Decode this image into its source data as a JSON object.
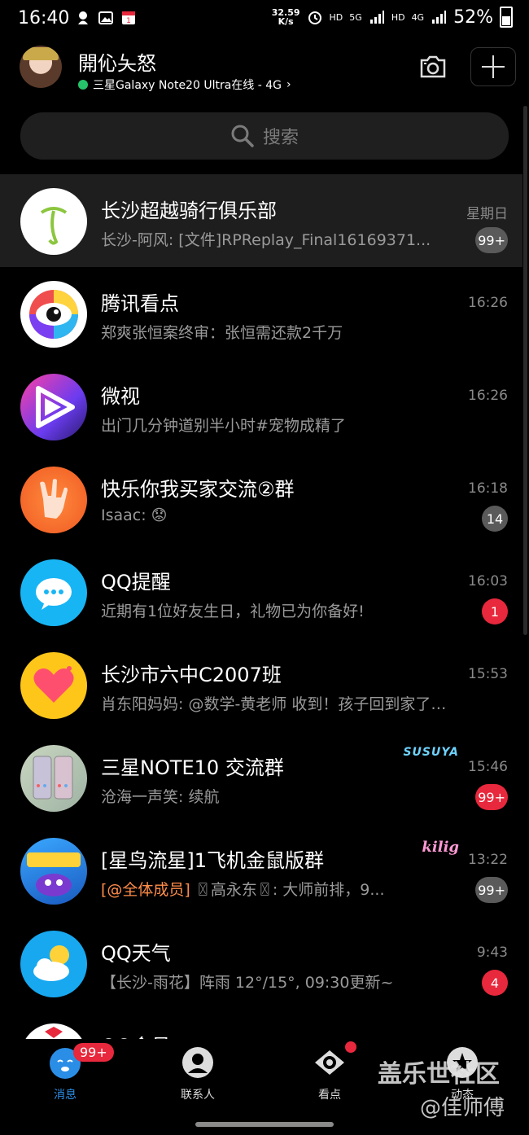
{
  "status_bar": {
    "time": "16:40",
    "speed_top": "32.59",
    "speed_bottom": "K/s",
    "hd1": "HD",
    "net5g": "5G",
    "hd2": "HD",
    "net4g": "4G",
    "battery": "52%"
  },
  "header": {
    "name": "開伈夨怒",
    "device_status": "三星Galaxy Note20 Ultra在线 - 4G",
    "chevron": "›"
  },
  "search": {
    "placeholder": "搜索"
  },
  "chats": [
    {
      "title": "长沙超越骑行俱乐部",
      "message": "长沙-阿风: [文件]RPReplay_Final16169371...",
      "time": "星期日",
      "badge": "99+",
      "badge_color": "grey",
      "pinned": true
    },
    {
      "title": "腾讯看点",
      "message": "郑爽张恒案终审：张恒需还款2千万",
      "time": "16:26",
      "badge": "",
      "badge_color": ""
    },
    {
      "title": "微视",
      "message": "出门几分钟道别半小时#宠物成精了",
      "time": "16:26",
      "badge": "",
      "badge_color": ""
    },
    {
      "title": "快乐你我买家交流②群",
      "message": "Isaac: 😟",
      "time": "16:18",
      "badge": "14",
      "badge_color": "grey"
    },
    {
      "title": "QQ提醒",
      "message": "近期有1位好友生日，礼物已为你备好!",
      "time": "16:03",
      "badge": "1",
      "badge_color": "red"
    },
    {
      "title": "长沙市六中C2007班",
      "message": "肖东阳妈妈: @数学-黄老师 收到！孩子回到家了我...",
      "time": "15:53",
      "badge": "",
      "badge_color": ""
    },
    {
      "title": "三星NOTE10 交流群",
      "message": "沧海一声笑: 续航",
      "time": "15:46",
      "badge": "99+",
      "badge_color": "red",
      "deco": "SUSUYA"
    },
    {
      "title": "[星鸟流星]1飞机金鼠版群",
      "message_at": "[@全体成员]",
      "message": " 〿高永东〿: 大师前排，9...",
      "time": "13:22",
      "badge": "99+",
      "badge_color": "grey",
      "deco": "kilig"
    },
    {
      "title": "QQ天气",
      "message": "【长沙-雨花】阵雨 12°/15°, 09:30更新~",
      "time": "9:43",
      "badge": "4",
      "badge_color": "red"
    },
    {
      "title": "QQ会员",
      "message": "",
      "time": "",
      "badge": "",
      "badge_color": ""
    }
  ],
  "bottom_nav": {
    "messages": "消息",
    "messages_badge": "99+",
    "contacts": "联系人",
    "watch": "看点",
    "moments": "动态"
  },
  "watermark": {
    "line1": "盖乐世社区",
    "line2": "@佳师傅"
  },
  "colors": {
    "accent": "#2b8ee6",
    "badge_red": "#e8283c",
    "badge_grey": "#5a5a5a",
    "online": "#27c36a"
  }
}
